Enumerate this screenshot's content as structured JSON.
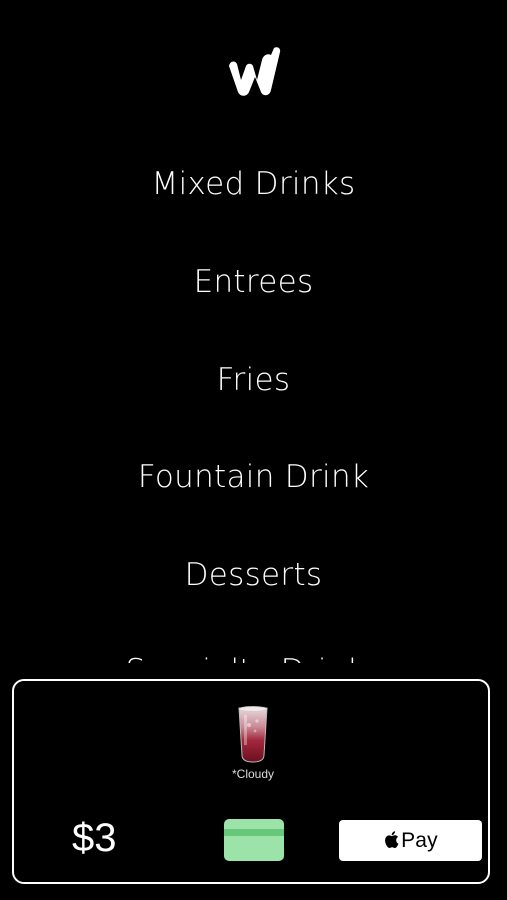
{
  "app": {
    "logo_icon": "brand-logo-icon"
  },
  "menu": {
    "items": [
      {
        "label": "Mixed Drinks"
      },
      {
        "label": "Entrees"
      },
      {
        "label": "Fries"
      },
      {
        "label": "Fountain Drink"
      },
      {
        "label": "Desserts"
      },
      {
        "label": "Specialty Drinks"
      }
    ]
  },
  "cart": {
    "item": {
      "label": "*Cloudy",
      "image_icon": "drink-cup-icon"
    },
    "total": "$3",
    "card_button_icon": "credit-card-icon",
    "applepay": {
      "label": "Pay",
      "icon": "apple-icon"
    }
  },
  "colors": {
    "background": "#000000",
    "text": "#ffffff",
    "card_green": "#9ce3a9",
    "card_stripe": "#66c878",
    "applepay_bg": "#ffffff"
  }
}
